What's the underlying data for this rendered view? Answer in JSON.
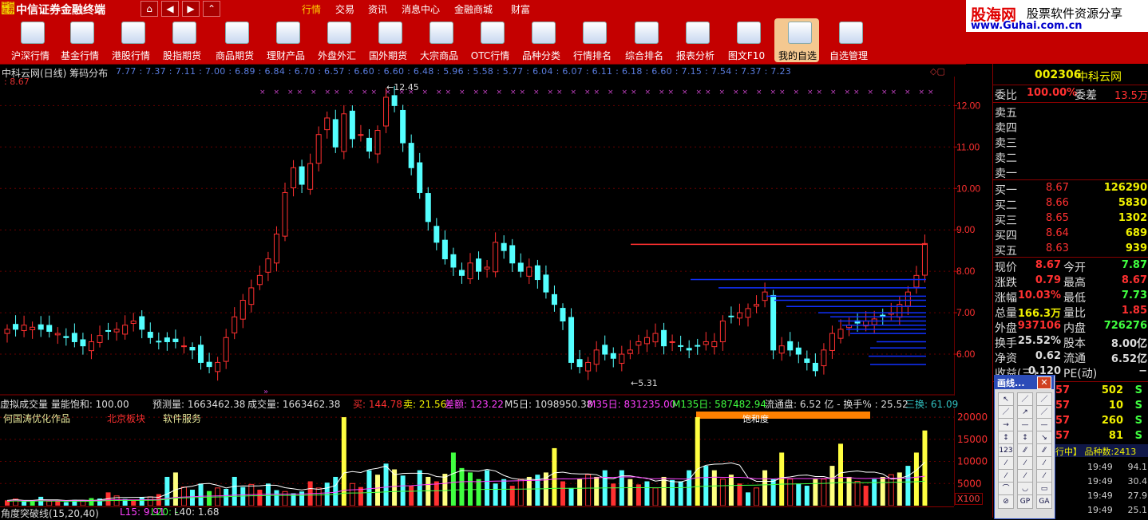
{
  "titlebar": {
    "logo": "中信证券",
    "app_title": "中信证券金融终端",
    "nav_buttons": [
      "⌂",
      "◀",
      "▶",
      "⌃"
    ],
    "menu": [
      "行情",
      "交易",
      "资讯",
      "消息中心",
      "金融商城",
      "财富"
    ],
    "brand_name": "股海网",
    "brand_slogan": "股票软件资源分享",
    "brand_url": "www.Guhai.com.cn"
  },
  "toolbar": {
    "items": [
      "沪深行情",
      "基金行情",
      "港股行情",
      "股指期货",
      "商品期货",
      "理财产品",
      "外盘外汇",
      "国外期货",
      "大宗商品",
      "OTC行情",
      "品种分类",
      "行情排名",
      "综合排名",
      "报表分析",
      "图文F10",
      "我的自选",
      "自选管理"
    ],
    "active": "我的自选"
  },
  "chart_header": {
    "title": "中科云网(日线) 筹码分布",
    "chip_values": "7.77 : 7.37 : 7.11 : 7.00 : 6.89 : 6.84 : 6.70 : 6.57 : 6.60 : 6.60 : 6.48 : 5.96 : 5.58 : 5.77 : 6.04 : 6.07 : 6.11 : 6.18 : 6.60 : 7.15 : 7.54 : 7.37 : 7.23",
    "price_tag": ": 8.67",
    "marker_high": "12.45",
    "marker_low": "5.31"
  },
  "chart_data": {
    "type": "candlestick",
    "y_axis_ticks": [
      "12.00",
      "11.00",
      "10.00",
      "9.00",
      "8.00",
      "7.00",
      "6.00"
    ],
    "ylim": [
      5.0,
      12.7
    ],
    "high_label": 12.45,
    "low_label": 5.31,
    "volume_axis_ticks": [
      "20000",
      "15000",
      "10000",
      "5000"
    ],
    "volume_multiplier": "X100"
  },
  "volume_panel": {
    "header_left": "虚拟成交量 量能饱和: 100.00",
    "forecast_label": "预测量: 1663462.38",
    "volume_label": "成交量: 1663462.38",
    "buy": "买: 144.78",
    "sell": "卖: 21.56",
    "diff": "差额: 123.22",
    "m5": "M5日: 1098950.38",
    "m35": "M35日: 831235.00",
    "m135": "M135日: 587482.94",
    "float": "流通盘: 6.52 亿 - 换手% : 25.52",
    "turnover3": "三换: 61.09",
    "author": "何国涛优化作品",
    "board": "北京板块",
    "sector": "软件服务",
    "saturation": "饱和度",
    "bottom_indicator": "角度突破线(15,20,40)",
    "l15": "L15: 9.91",
    "l20": "L20: -",
    "l40": "L40: 1.68"
  },
  "quote_panel": {
    "code": "002306",
    "name": "中科云网",
    "ratio_label": "委比",
    "ratio_value": "100.00%",
    "diff_label": "委差",
    "diff_value": "13.5万",
    "asks": [
      {
        "label": "卖五",
        "price": "",
        "vol": ""
      },
      {
        "label": "卖四",
        "price": "",
        "vol": ""
      },
      {
        "label": "卖三",
        "price": "",
        "vol": ""
      },
      {
        "label": "卖二",
        "price": "",
        "vol": ""
      },
      {
        "label": "卖一",
        "price": "",
        "vol": ""
      }
    ],
    "bids": [
      {
        "label": "买一",
        "price": "8.67",
        "vol": "126290"
      },
      {
        "label": "买二",
        "price": "8.66",
        "vol": "5830"
      },
      {
        "label": "买三",
        "price": "8.65",
        "vol": "1302"
      },
      {
        "label": "买四",
        "price": "8.64",
        "vol": "689"
      },
      {
        "label": "买五",
        "price": "8.63",
        "vol": "939"
      }
    ],
    "stats": [
      {
        "l1": "现价",
        "v1": "8.67",
        "l2": "今开",
        "v2": "7.87"
      },
      {
        "l1": "涨跌",
        "v1": "0.79",
        "l2": "最高",
        "v2": "8.67"
      },
      {
        "l1": "涨幅",
        "v1": "10.03%",
        "l2": "最低",
        "v2": "7.73"
      },
      {
        "l1": "总量",
        "v1": "166.3万",
        "l2": "量比",
        "v2": "1.85"
      },
      {
        "l1": "外盘",
        "v1": "937106",
        "l2": "内盘",
        "v2": "726276"
      },
      {
        "l1": "换手",
        "v1": "25.52%",
        "l2": "股本",
        "v2": "8.00亿"
      },
      {
        "l1": "净资",
        "v1": "0.62",
        "l2": "流通",
        "v2": "6.52亿"
      },
      {
        "l1": "收益(三)",
        "v1": "0.120",
        "l2": "PE(动)",
        "v2": "−"
      }
    ],
    "ticks": [
      {
        "p": "57",
        "v": "502",
        "s": "S"
      },
      {
        "p": "57",
        "v": "10",
        "s": "S"
      },
      {
        "p": "57",
        "v": "260",
        "s": "S"
      },
      {
        "p": "57",
        "v": "81",
        "s": "S"
      }
    ],
    "tab_label": "行中】 品种数:2413",
    "times": [
      {
        "t": "19:49",
        "v": "94.1"
      },
      {
        "t": "19:49",
        "v": "30.4"
      },
      {
        "t": "19:49",
        "v": "27.9"
      },
      {
        "t": "19:49",
        "v": "25.1"
      }
    ]
  },
  "draw_toolbox": {
    "title": "画线..."
  }
}
